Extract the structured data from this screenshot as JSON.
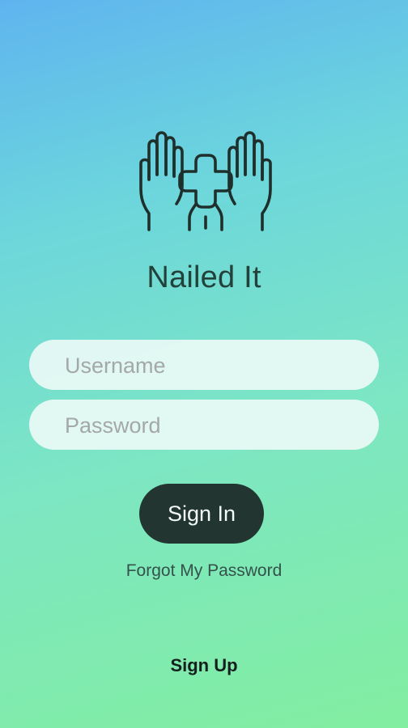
{
  "app": {
    "title": "Nailed It",
    "logo_icon": "hands-medical-cross-icon"
  },
  "form": {
    "username_placeholder": "Username",
    "username_value": "",
    "password_placeholder": "Password",
    "password_value": ""
  },
  "actions": {
    "sign_in_label": "Sign In",
    "forgot_label": "Forgot My Password",
    "sign_up_label": "Sign Up"
  },
  "colors": {
    "gradient_top": "#5fb4ef",
    "gradient_bottom": "#82eea0",
    "button_bg": "#223530",
    "text_dark": "#23413b"
  }
}
